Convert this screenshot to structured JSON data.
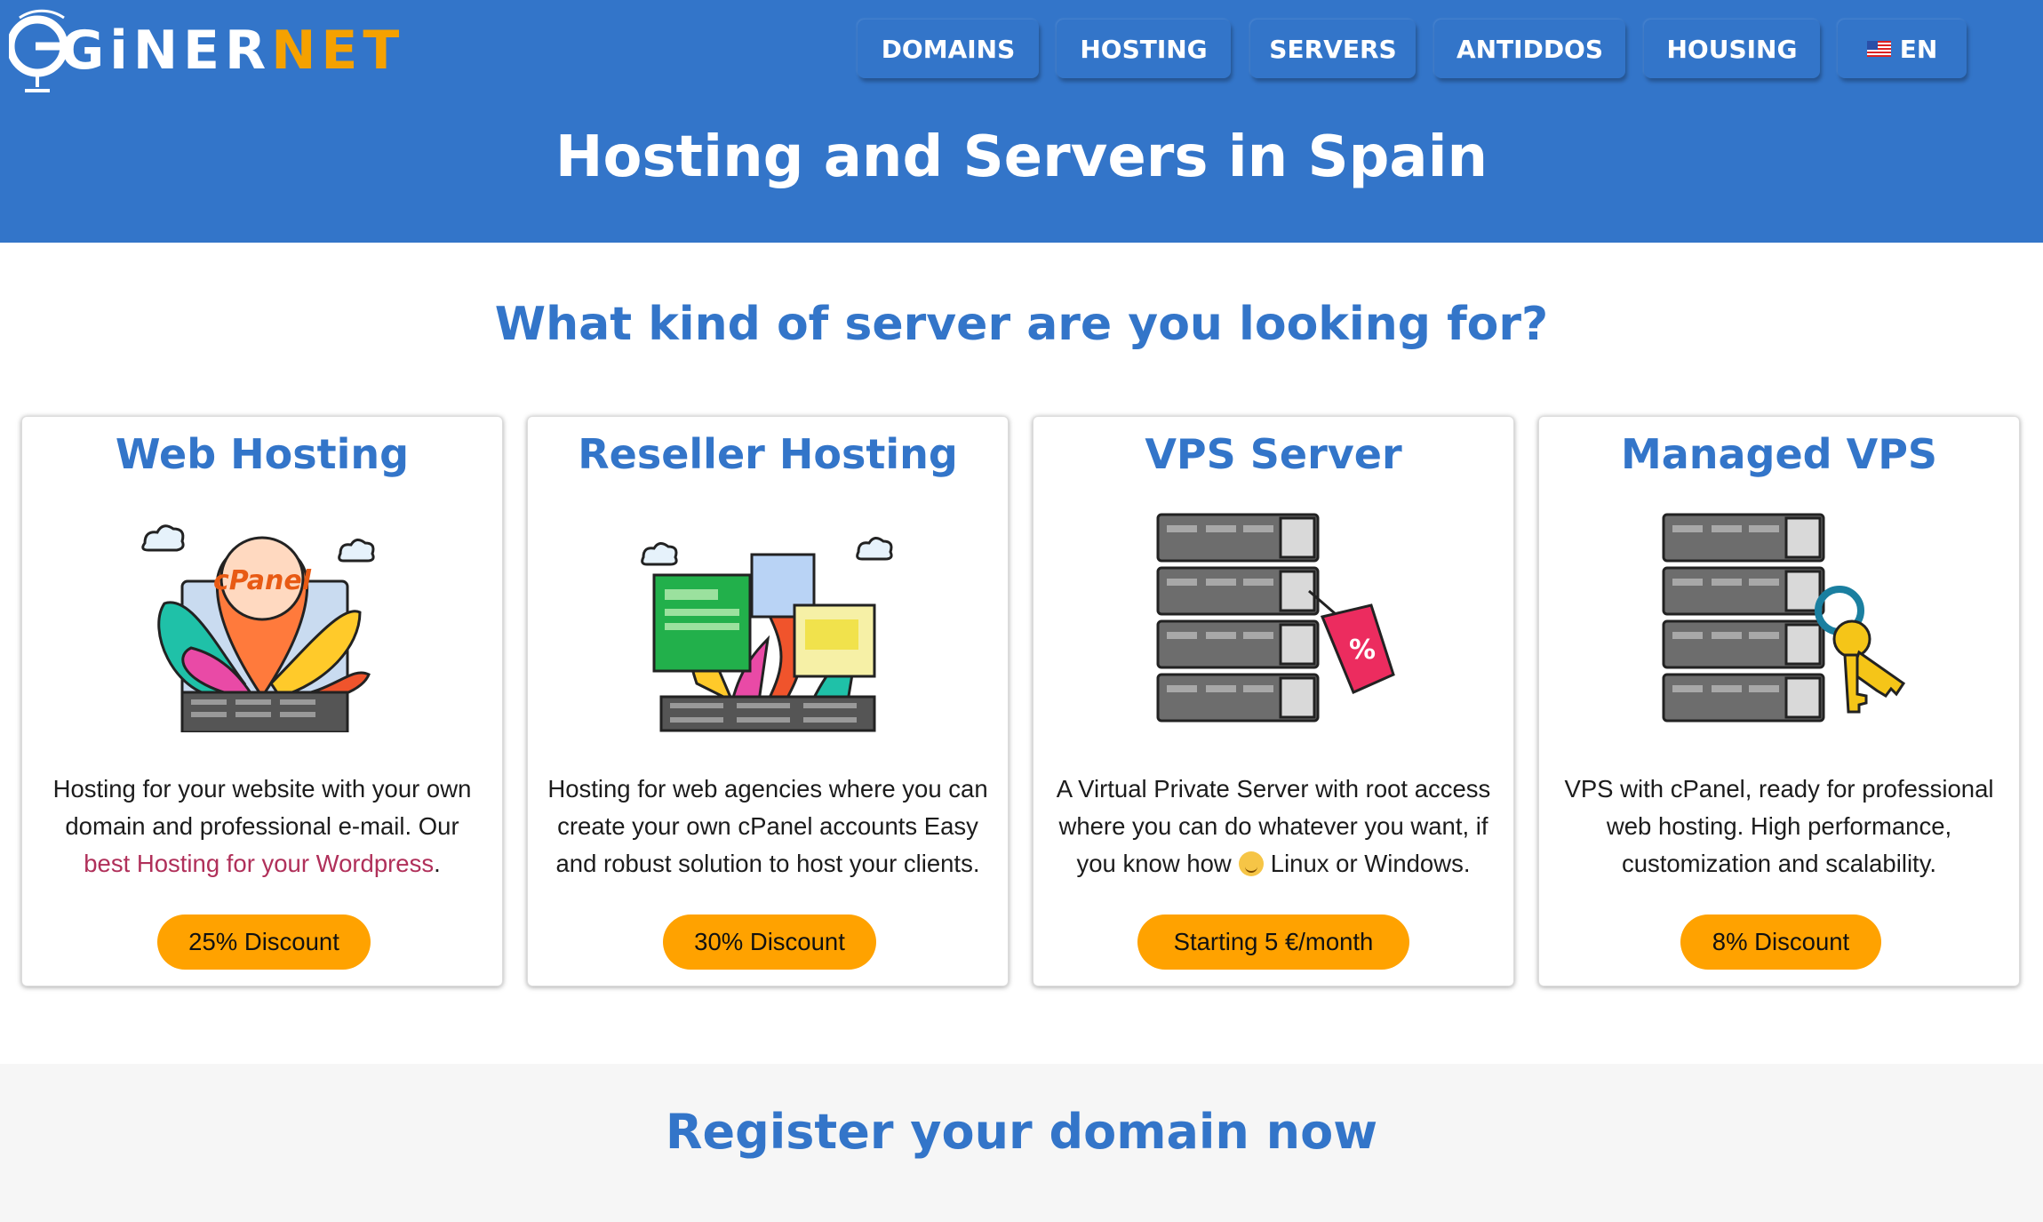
{
  "logo": {
    "part1": "GiNER",
    "part2": "NET"
  },
  "nav": {
    "items": [
      "DOMAINS",
      "HOSTING",
      "SERVERS",
      "ANTIDDOS",
      "HOUSING"
    ],
    "lang": "EN"
  },
  "header": {
    "title": "Hosting and Servers in Spain"
  },
  "main": {
    "question": "What kind of server are you looking for?",
    "cards": [
      {
        "title": "Web Hosting",
        "desc_pre": "Hosting for your website with your own domain and professional e-mail. Our",
        "link": "best Hosting for your Wordpress",
        "desc_post": ".",
        "button": "25% Discount",
        "icon": "cpanel-hosting-icon"
      },
      {
        "title": "Reseller Hosting",
        "desc": "Hosting for web agencies where you can create your own cPanel accounts Easy and robust solution to host your clients.",
        "button": "30% Discount",
        "icon": "reseller-hosting-icon"
      },
      {
        "title": "VPS Server",
        "desc_pre": "A Virtual Private Server with root access where you can do whatever you want, if you know how",
        "desc_post": "Linux or Windows.",
        "button": "Starting 5 €/month",
        "icon": "vps-server-discount-icon"
      },
      {
        "title": "Managed VPS",
        "desc": "VPS with cPanel, ready for professional web hosting. High performance, customization and scalability.",
        "button": "8% Discount",
        "icon": "managed-vps-keys-icon"
      }
    ]
  },
  "register": {
    "title": "Register your domain now"
  },
  "colors": {
    "primary": "#3375c9",
    "accent": "#ffa200",
    "logo_accent": "#f5a100",
    "link": "#b0305a"
  }
}
